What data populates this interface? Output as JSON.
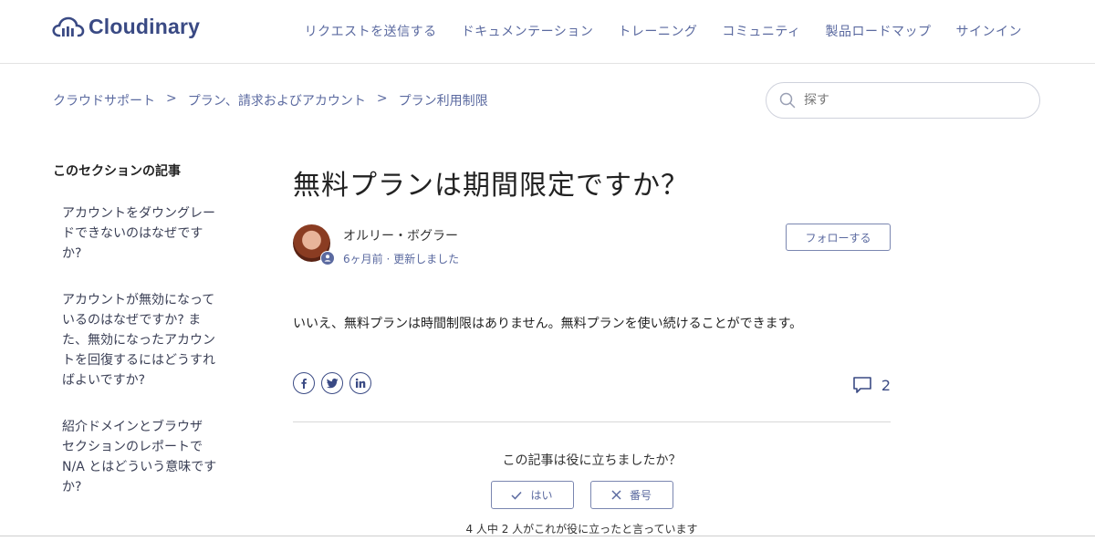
{
  "header": {
    "logo_text": "Cloudinary",
    "nav": [
      {
        "label": "リクエストを送信する"
      },
      {
        "label": "ドキュメンテーション"
      },
      {
        "label": "トレーニング"
      },
      {
        "label": "コミュニティ"
      },
      {
        "label": "製品ロードマップ"
      },
      {
        "label": "サインイン"
      }
    ]
  },
  "breadcrumb": {
    "items": [
      "クラウドサポート",
      "プラン、請求およびアカウント",
      "プラン利用制限"
    ],
    "separator": ">"
  },
  "search": {
    "placeholder": "探す",
    "icon": "search-icon"
  },
  "sidebar": {
    "title": "このセクションの記事",
    "items": [
      "アカウントをダウングレードできないのはなぜですか?",
      "アカウントが無効になっているのはなぜですか? また、無効になったアカウントを回復するにはどうすればよいですか?",
      "紹介ドメインとブラウザ セクションのレポートで N/A とはどういう意味ですか?"
    ]
  },
  "article": {
    "title": "無料プランは期間限定ですか？",
    "author": {
      "name": "オルリー・ボグラー",
      "time": "6ヶ月前",
      "meta_sep": "·",
      "updated": "更新しました"
    },
    "follow_label": "フォローする",
    "body": "いいえ、無料プランは時間制限はありません。無料プランを使い続けることができます。",
    "share_icons": [
      "facebook-icon",
      "twitter-icon",
      "linkedin-icon"
    ],
    "comment_count": "2"
  },
  "vote": {
    "question": "この記事は役に立ちましたか？",
    "yes_label": "はい",
    "no_label": "番号",
    "summary": "4 人中 2 人がこれが役に立ったと言っています"
  },
  "colors": {
    "brand": "#3a4a84",
    "link": "#5b6aa0",
    "border": "#cfd2dc"
  }
}
